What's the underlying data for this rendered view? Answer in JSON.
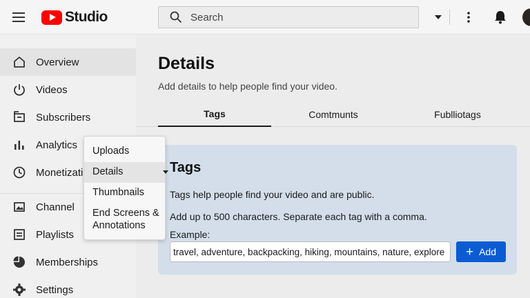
{
  "header": {
    "logo_text": "Studio",
    "search_placeholder": "Search"
  },
  "sidebar": {
    "items": [
      {
        "label": "Overview",
        "icon": "home-icon"
      },
      {
        "label": "Videos",
        "icon": "power-icon"
      },
      {
        "label": "Subscribers",
        "icon": "subscribers-icon"
      },
      {
        "label": "Analytics",
        "icon": "bar-chart-icon"
      },
      {
        "label": "Monetizati",
        "icon": "clock-icon"
      },
      {
        "label": "Channel",
        "icon": "image-icon"
      },
      {
        "label": "Playlists",
        "icon": "playlist-icon"
      },
      {
        "label": "Memberships",
        "icon": "pie-icon"
      },
      {
        "label": "Settings",
        "icon": "gear-icon"
      }
    ]
  },
  "main": {
    "title": "Details",
    "subtitle": "Add details to help people find your video.",
    "tabs": [
      {
        "label": "Tags"
      },
      {
        "label": "Comtmunts"
      },
      {
        "label": "Fublliotags"
      }
    ]
  },
  "tags_card": {
    "title": "Tags",
    "line1": "Tags help people find your video and are public.",
    "line2": "Add up to 500 characters. Separate each tag with a comma.",
    "example_label": "Example:",
    "input_value": "travel, adventure, backpacking, hiking, mountains, nature, explore",
    "add_plus": "+",
    "add_label": "Add"
  },
  "popup": {
    "items": [
      {
        "label": "Uploads"
      },
      {
        "label": "Details"
      },
      {
        "label": "Thumbnails"
      },
      {
        "label": "End Screens &"
      },
      {
        "label": "Annotations"
      }
    ]
  },
  "colors": {
    "brand_red": "#ff0000",
    "accent_blue": "#0b5bd3",
    "card_bg": "#d3deea"
  }
}
